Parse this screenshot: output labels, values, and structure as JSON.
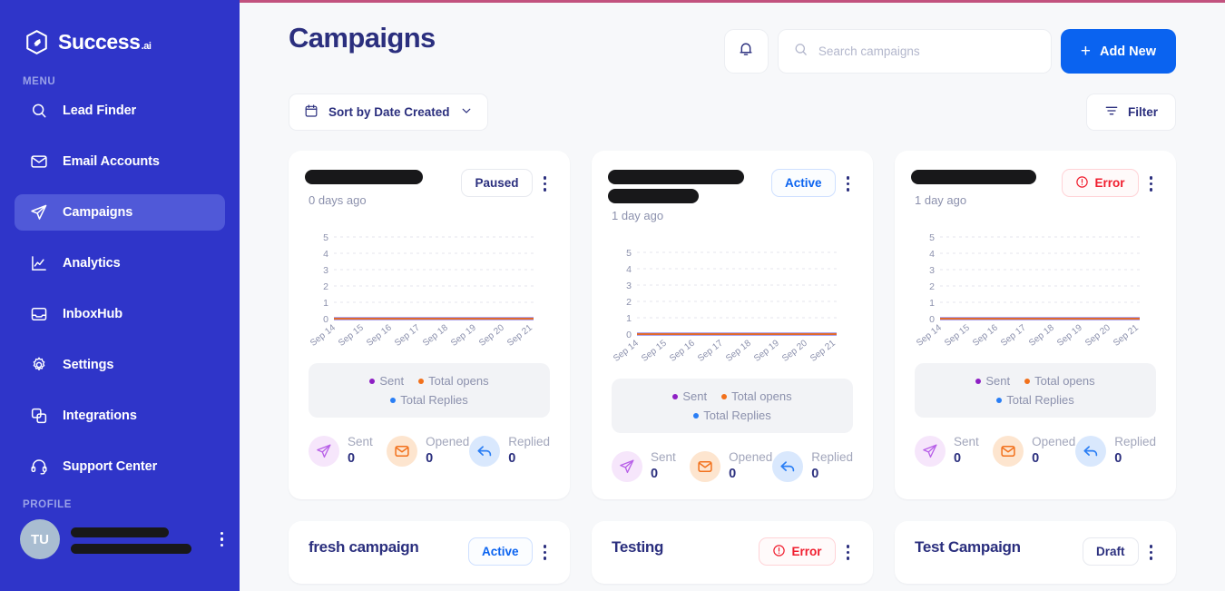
{
  "brand": {
    "name": "Success",
    "suffix": ".ai"
  },
  "sidebar": {
    "menu_label": "MENU",
    "profile_label": "PROFILE",
    "items": [
      {
        "label": "Lead Finder",
        "icon": "search-icon",
        "active": false
      },
      {
        "label": "Email Accounts",
        "icon": "envelope-icon",
        "active": false
      },
      {
        "label": "Campaigns",
        "icon": "paper-plane-icon",
        "active": true
      },
      {
        "label": "Analytics",
        "icon": "chart-line-icon",
        "active": false
      },
      {
        "label": "InboxHub",
        "icon": "inbox-icon",
        "active": false
      },
      {
        "label": "Settings",
        "icon": "gear-icon",
        "active": false
      },
      {
        "label": "Integrations",
        "icon": "layers-icon",
        "active": false
      },
      {
        "label": "Support Center",
        "icon": "headset-icon",
        "active": false
      }
    ],
    "profile": {
      "initials": "TU",
      "name_redacted": true,
      "email_redacted": true
    }
  },
  "header": {
    "title": "Campaigns",
    "bell_icon": "bell-icon",
    "search": {
      "placeholder": "Search campaigns",
      "value": "",
      "icon": "search-icon"
    },
    "add_new": {
      "label": "Add New",
      "icon": "plus-icon"
    },
    "sort": {
      "label": "Sort by Date Created",
      "icon": "calendar-icon",
      "chevron": "chevron-down-icon"
    },
    "filter": {
      "label": "Filter",
      "icon": "filter-icon"
    }
  },
  "legend": {
    "sent": {
      "label": "Sent",
      "color": "#8e1fc4"
    },
    "total_opens": {
      "label": "Total opens",
      "color": "#f2711c"
    },
    "total_replies": {
      "label": "Total Replies",
      "color": "#2a7ef5"
    }
  },
  "stat_labels": {
    "sent": "Sent",
    "opened": "Opened",
    "replied": "Replied"
  },
  "chart_data": {
    "type": "line",
    "x": [
      "Sep 14",
      "Sep 15",
      "Sep 16",
      "Sep 17",
      "Sep 18",
      "Sep 19",
      "Sep 20",
      "Sep 21"
    ],
    "yticks": [
      0,
      1,
      2,
      3,
      4,
      5
    ],
    "ylim": [
      0,
      5
    ],
    "grid": true,
    "legend_position": "below",
    "series": [
      {
        "name": "Sent",
        "color": "#8e1fc4",
        "values": [
          0,
          0,
          0,
          0,
          0,
          0,
          0,
          0
        ]
      },
      {
        "name": "Total opens",
        "color": "#f2711c",
        "values": [
          0,
          0,
          0,
          0,
          0,
          0,
          0,
          0
        ]
      },
      {
        "name": "Total Replies",
        "color": "#2a7ef5",
        "values": [
          0,
          0,
          0,
          0,
          0,
          0,
          0,
          0
        ]
      }
    ],
    "title": "",
    "xlabel": "",
    "ylabel": ""
  },
  "cards": [
    {
      "title": "",
      "title_redacted": true,
      "redact_widths": [
        130,
        0
      ],
      "age": "0 days ago",
      "status": {
        "label": "Paused",
        "kind": "paused",
        "icon": null
      },
      "stats": {
        "sent": "0",
        "opened": "0",
        "replied": "0"
      }
    },
    {
      "title": "",
      "title_redacted": true,
      "redact_widths": [
        150,
        100
      ],
      "age": "1 day ago",
      "status": {
        "label": "Active",
        "kind": "active",
        "icon": null
      },
      "stats": {
        "sent": "0",
        "opened": "0",
        "replied": "0"
      }
    },
    {
      "title": "",
      "title_redacted": true,
      "redact_widths": [
        138,
        0
      ],
      "age": "1 day ago",
      "status": {
        "label": "Error",
        "kind": "error",
        "icon": "alert-circle-icon"
      },
      "stats": {
        "sent": "0",
        "opened": "0",
        "replied": "0"
      }
    }
  ],
  "cards_row2": [
    {
      "title": "fresh campaign",
      "status": {
        "label": "Active",
        "kind": "active",
        "icon": null
      }
    },
    {
      "title": "Testing",
      "status": {
        "label": "Error",
        "kind": "error",
        "icon": "alert-circle-icon"
      }
    },
    {
      "title": "Test Campaign",
      "status": {
        "label": "Draft",
        "kind": "draft",
        "icon": null
      }
    }
  ]
}
